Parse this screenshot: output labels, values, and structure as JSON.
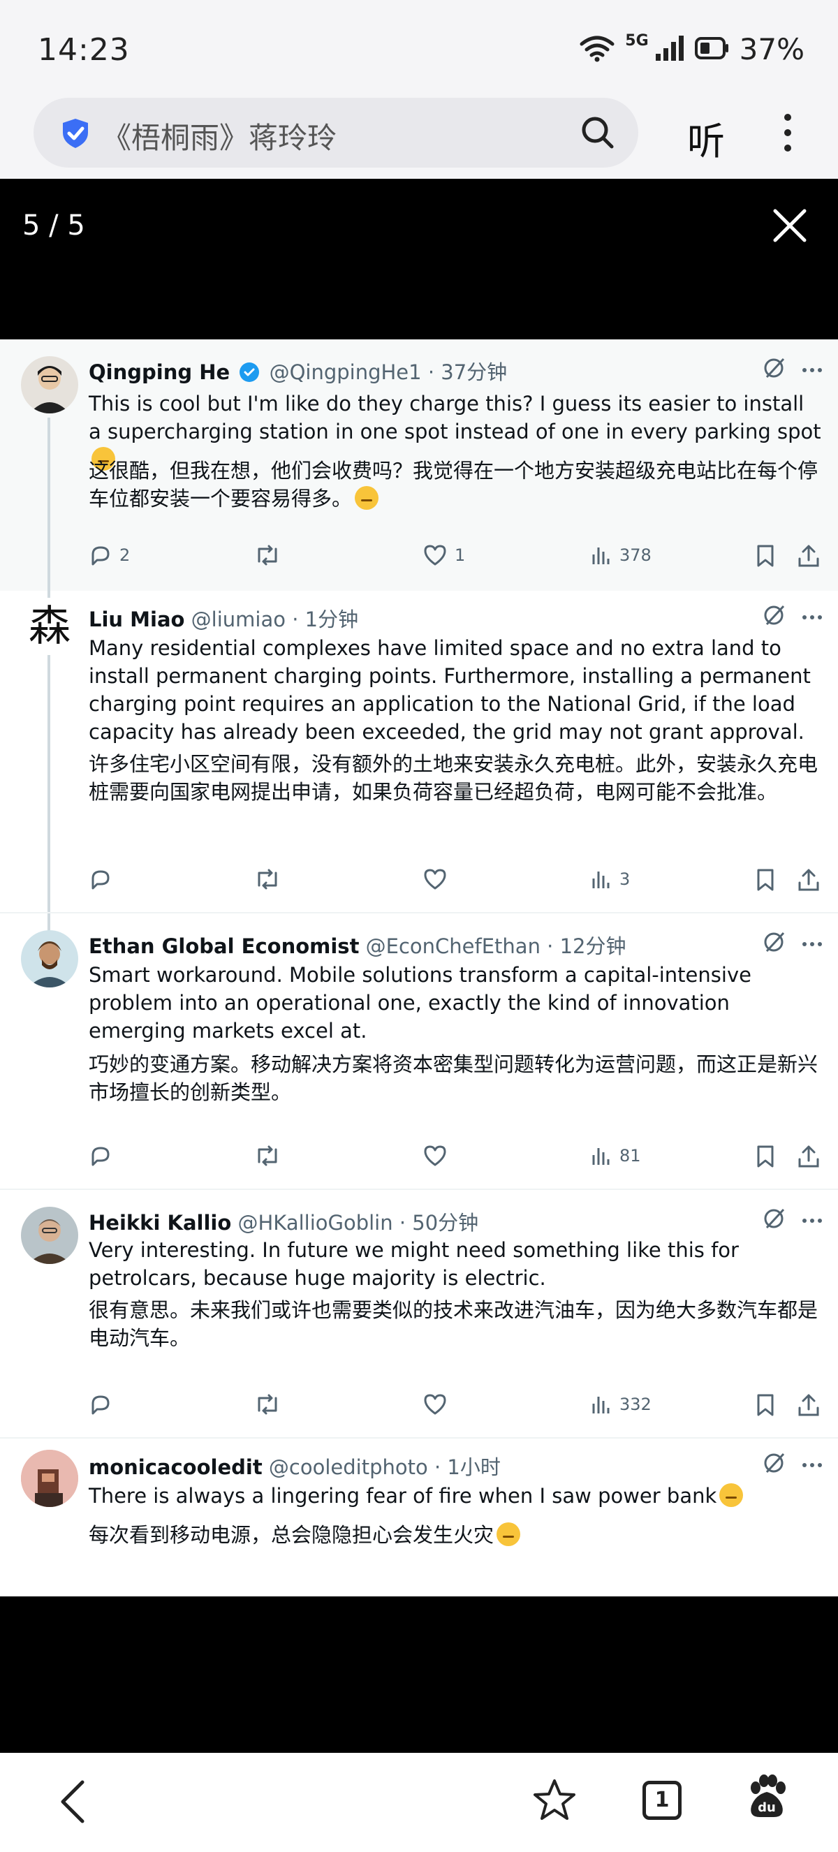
{
  "status_bar": {
    "time": "14:23",
    "network": "5G",
    "battery": "37%"
  },
  "browser": {
    "url_text": "《梧桐雨》蒋玲玲",
    "listen_label": "听"
  },
  "viewer": {
    "counter": "5 / 5"
  },
  "tweets": [
    {
      "name": "Qingping He",
      "verified": true,
      "handle": "@QingpingHe1",
      "time": "37分钟",
      "text": "This is cool but I'm like do they charge this? I guess its easier to install a supercharging station in one spot instead of one in every parking spot",
      "translation": "这很酷，但我在想，他们会收费吗？我觉得在一个地方安装超级充电站比在每个停车位都安装一个要容易得多。",
      "replies": "2",
      "retweets": "",
      "likes": "1",
      "views": "378"
    },
    {
      "name": "Liu Miao",
      "verified": false,
      "handle": "@liumiao",
      "time": "1分钟",
      "avatar_glyph": "森",
      "text": "Many residential complexes have limited space and no extra land to install permanent charging points. Furthermore, installing a permanent charging point requires an application to the National Grid, if the load capacity has already been exceeded, the grid may not grant approval.",
      "translation": "许多住宅小区空间有限，没有额外的土地来安装永久充电桩。此外，安装永久充电桩需要向国家电网提出申请，如果负荷容量已经超负荷，电网可能不会批准。",
      "replies": "",
      "retweets": "",
      "likes": "",
      "views": "3"
    },
    {
      "name": "Ethan Global Economist",
      "verified": false,
      "handle": "@EconChefEthan",
      "time": "12分钟",
      "text": "Smart workaround. Mobile solutions transform a capital-intensive problem into an operational one, exactly the kind of innovation emerging markets excel at.",
      "translation": "巧妙的变通方案。移动解决方案将资本密集型问题转化为运营问题，而这正是新兴市场擅长的创新类型。",
      "replies": "",
      "retweets": "",
      "likes": "",
      "views": "81"
    },
    {
      "name": "Heikki Kallio",
      "verified": false,
      "handle": "@HKallioGoblin",
      "time": "50分钟",
      "text": "Very interesting. In future we might need something like this for petrolcars, because huge majority is electric.",
      "translation": "很有意思。未来我们或许也需要类似的技术来改进汽油车，因为绝大多数汽车都是电动汽车。",
      "replies": "",
      "retweets": "",
      "likes": "",
      "views": "332"
    },
    {
      "name": "monicacooledit",
      "verified": false,
      "handle": "@cooleditphoto",
      "time": "1小时",
      "text": "There is always a lingering fear of fire when I saw power bank",
      "translation": "每次看到移动电源，总会隐隐担心会发生火灾"
    }
  ],
  "bottom_nav": {
    "tabs_count": "1"
  },
  "colors": {
    "accent_verified": "#1d9bf0",
    "secondary_text": "#536471",
    "black": "#000000"
  },
  "icons": [
    "wifi-icon",
    "signal-icon",
    "battery-icon",
    "shield-icon",
    "search-icon",
    "more-vertical-icon",
    "close-icon",
    "reply-icon",
    "retweet-icon",
    "like-icon",
    "views-icon",
    "bookmark-icon",
    "share-icon",
    "grok-icon",
    "more-horizontal-icon",
    "back-icon",
    "star-icon",
    "baidu-paw-icon"
  ]
}
